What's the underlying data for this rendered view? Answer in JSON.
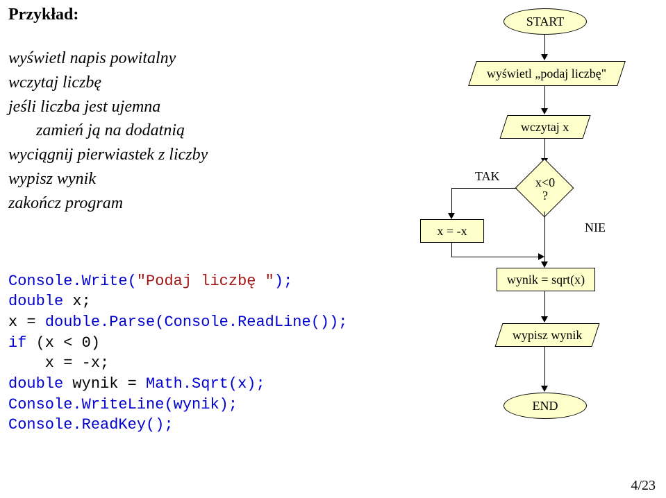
{
  "heading": "Przykład:",
  "desc": {
    "l1": "wyświetl napis powitalny",
    "l2": "wczytaj liczbę",
    "l3": "jeśli liczba jest ujemna",
    "l4": "zamień ją na dodatnią",
    "l5": "wyciągnij pierwiastek z liczby",
    "l6": "wypisz wynik",
    "l7": "zakończ program"
  },
  "code": {
    "Console": "Console",
    "Write": ".Write(",
    "str": "\"Podaj liczbę \"",
    "close1": ");",
    "doubleDecl": "double",
    "xname": " x;",
    "assignx": "x = ",
    "doubleType": "double",
    "parse": ".Parse(",
    "readline": ".ReadLine());",
    "ifkw": "if",
    "ifcond": " (x < 0)",
    "negx": "    x = -x;",
    "wynikDecl": " wynik = ",
    "Math": "Math",
    "sqrt": ".Sqrt(x);",
    "writeline": ".WriteLine(wynik);",
    "readkey": ".ReadKey();"
  },
  "flow": {
    "start": "START",
    "prompt": "wyświetl „podaj liczbę\"",
    "read": "wczytaj x",
    "decision": "x<0\n?",
    "tak": "TAK",
    "nie": "NIE",
    "neg": "x = -x",
    "sqrt": "wynik = sqrt(x)",
    "print": "wypisz wynik",
    "end": "END"
  },
  "chart_data": {
    "type": "flowchart",
    "nodes": [
      {
        "id": "start",
        "shape": "terminator",
        "label": "START"
      },
      {
        "id": "prompt",
        "shape": "io-parallelogram",
        "label": "wyświetl „podaj liczbę\""
      },
      {
        "id": "read",
        "shape": "io-parallelogram",
        "label": "wczytaj x"
      },
      {
        "id": "dec",
        "shape": "decision",
        "label": "x<0 ?"
      },
      {
        "id": "neg",
        "shape": "process",
        "label": "x = -x"
      },
      {
        "id": "sqrt",
        "shape": "process",
        "label": "wynik = sqrt(x)"
      },
      {
        "id": "print",
        "shape": "io-parallelogram",
        "label": "wypisz wynik"
      },
      {
        "id": "end",
        "shape": "terminator",
        "label": "END"
      }
    ],
    "edges": [
      {
        "from": "start",
        "to": "prompt"
      },
      {
        "from": "prompt",
        "to": "read"
      },
      {
        "from": "read",
        "to": "dec"
      },
      {
        "from": "dec",
        "to": "neg",
        "label": "TAK"
      },
      {
        "from": "dec",
        "to": "sqrt",
        "label": "NIE"
      },
      {
        "from": "neg",
        "to": "sqrt"
      },
      {
        "from": "sqrt",
        "to": "print"
      },
      {
        "from": "print",
        "to": "end"
      }
    ]
  },
  "page": "4/23"
}
